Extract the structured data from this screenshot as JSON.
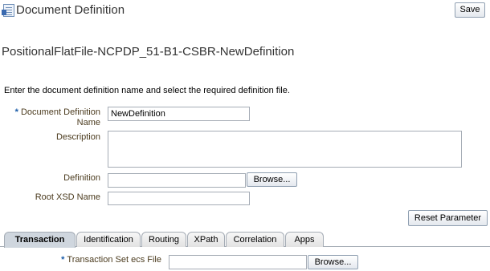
{
  "header": {
    "title": "Document Definition",
    "save_label": "Save"
  },
  "section": {
    "title": "PositionalFlatFile-NCPDP_51-B1-CSBR-NewDefinition",
    "instructions": "Enter the document definition name and select the required definition file."
  },
  "form": {
    "doc_def_name_label": "Document Definition Name",
    "doc_def_name_value": "NewDefinition",
    "description_label": "Description",
    "description_value": "",
    "definition_label": "Definition",
    "definition_value": "",
    "browse_label": "Browse...",
    "root_xsd_label": "Root XSD Name",
    "root_xsd_value": "",
    "reset_label": "Reset Parameter"
  },
  "tabs": [
    {
      "label": "Transaction",
      "active": true
    },
    {
      "label": "Identification",
      "active": false
    },
    {
      "label": "Routing",
      "active": false
    },
    {
      "label": "XPath",
      "active": false
    },
    {
      "label": "Correlation",
      "active": false
    },
    {
      "label": "Apps",
      "active": false
    }
  ],
  "transaction": {
    "ecs_file_label": "Transaction Set ecs File",
    "ecs_file_value": "",
    "browse_label": "Browse..."
  },
  "colors": {
    "label_text": "#4b3b1e",
    "required_marker": "#1a5ca8",
    "active_tab": "#cfd6de"
  },
  "icons": {
    "page": "document-definition-icon"
  }
}
